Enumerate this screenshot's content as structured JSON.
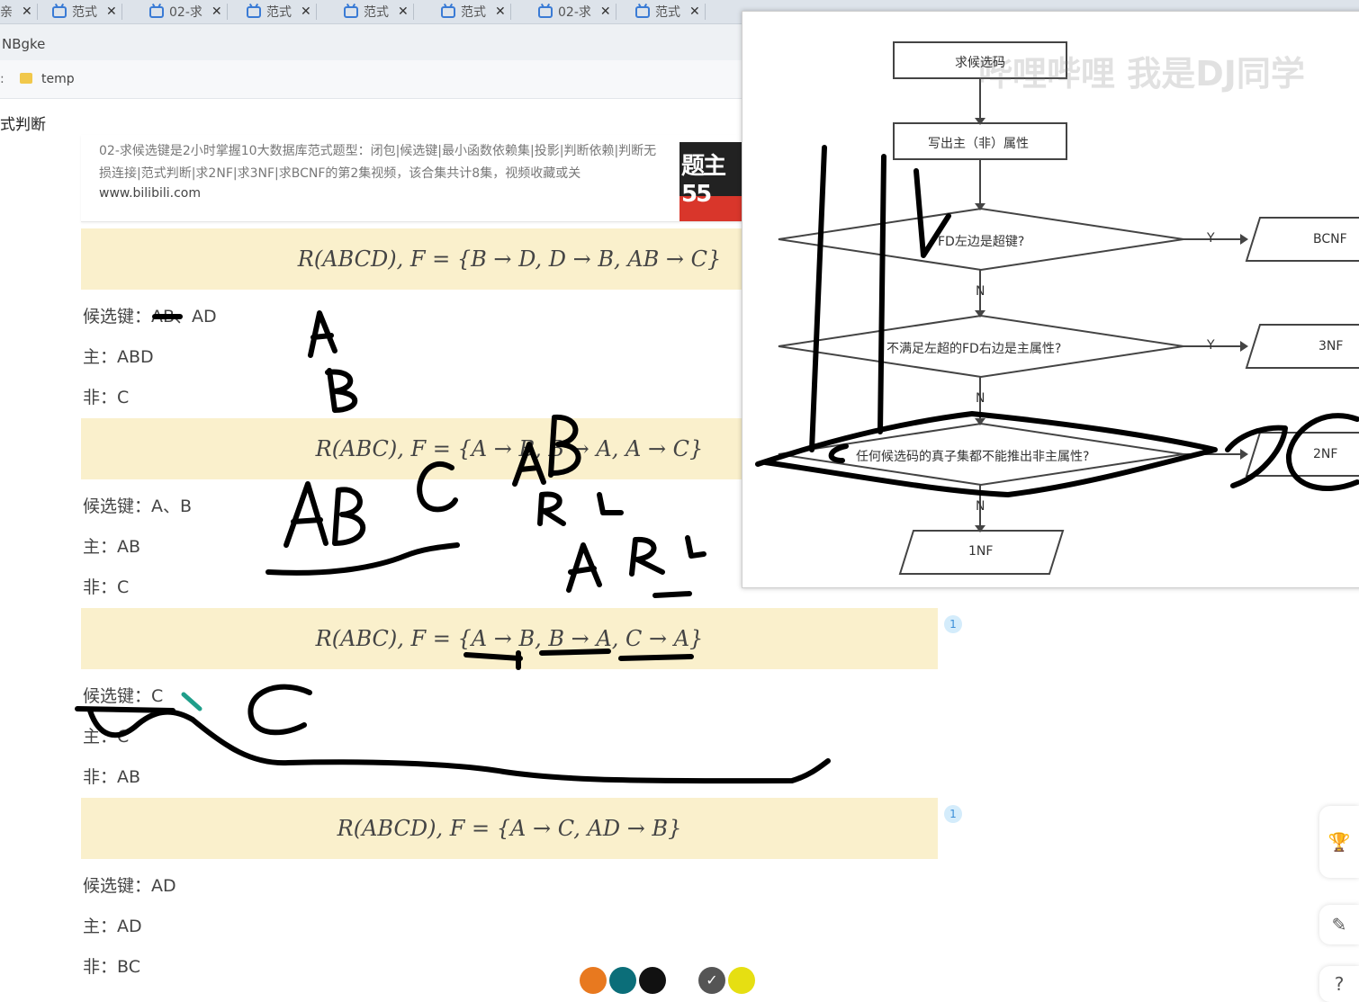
{
  "tabs": [
    {
      "label": "亲",
      "type": "partial"
    },
    {
      "label": "范式"
    },
    {
      "label": "02-求"
    },
    {
      "label": "范式"
    },
    {
      "label": "范式"
    },
    {
      "label": "范式"
    },
    {
      "label": "02-求"
    },
    {
      "label": "范式"
    }
  ],
  "address": {
    "text": "NBgke"
  },
  "bookmarks": {
    "folder_label": "temp"
  },
  "page_title": "式判断",
  "card": {
    "description": "02-求候选键是2小时掌握10大数据库范式题型：闭包|候选键|最小函数依赖集|投影|判断依赖|判断无损连接|范式判断|求2NF|求3NF|求BCNF的第2集视频，该合集共计8集，视频收藏或关",
    "url": "www.bilibili.com"
  },
  "problems": [
    {
      "formula": "R(ABCD), F = {B → D, D → B, AB → C}",
      "candidate": "候选键：AB、AD",
      "primary": "主：ABD",
      "non": "非：C"
    },
    {
      "formula": "R(ABC), F = {A → B, B → A, A → C}",
      "candidate": "候选键：A、B",
      "primary": "主：AB",
      "non": "非：C"
    },
    {
      "formula": "R(ABC), F = {A → B, B → A, C → A}",
      "candidate": "候选键：C",
      "primary": "主：C",
      "non": "非：AB",
      "badge": "1"
    },
    {
      "formula": "R(ABCD), F = {A → C, AD → B}",
      "candidate": "候选键：AD",
      "primary": "主：AD",
      "non": "非：BC",
      "badge": "1"
    }
  ],
  "flowchart": {
    "start": "求候选码",
    "step2": "写出主（非）属性",
    "q1": "FD左边是超键?",
    "q2": "不满足左超的FD右边是主属性?",
    "q3": "任何候选码的真子集都不能推出非主属性?",
    "yes": "Y",
    "no": "N",
    "r1": "BCNF",
    "r2": "3NF",
    "r3": "2NF",
    "r4": "1NF",
    "watermark": "哔哩哔哩 我是DJ同学"
  },
  "palette": [
    "#e8791f",
    "#0b6e79",
    "#111111",
    "#555555",
    "#e6df12"
  ],
  "side_icons": [
    "trophy-icon",
    "note-edit-icon",
    "help-icon"
  ],
  "help_text": "?"
}
